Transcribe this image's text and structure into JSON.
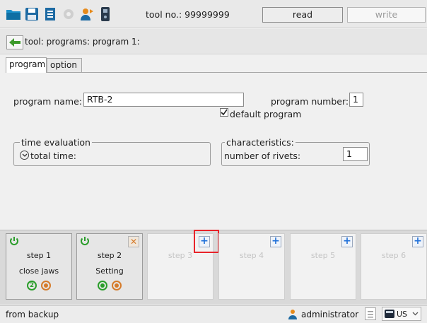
{
  "toolbar": {
    "icons": [
      "folder-icon",
      "save-icon",
      "document-list-icon",
      "settings-gear-icon",
      "user-transfer-icon",
      "device-icon"
    ],
    "tool_no": "tool no.: 99999999",
    "read_label": "read",
    "write_label": "write"
  },
  "breadcrumb": {
    "text": "tool: programs: program 1:"
  },
  "tabs": [
    {
      "label": "program",
      "active": true
    },
    {
      "label": "option",
      "active": false
    }
  ],
  "program": {
    "name_label": "program name:",
    "name_value": "RTB-2",
    "number_label": "program number:",
    "number_value": "1",
    "default_checkbox_label": "default program",
    "default_checked": true
  },
  "time_evaluation": {
    "title": "time evaluation",
    "total_time_label": "total time:"
  },
  "characteristics": {
    "title": "characteristics:",
    "rivets_label": "number of rivets:",
    "rivets_value": "1"
  },
  "steps": [
    {
      "label": "step 1",
      "desc": "close jaws",
      "state": "active",
      "badge": "2"
    },
    {
      "label": "step 2",
      "desc": "Setting",
      "state": "active",
      "badge": ""
    },
    {
      "label": "step 3",
      "desc": "",
      "state": "empty"
    },
    {
      "label": "step 4",
      "desc": "",
      "state": "empty"
    },
    {
      "label": "step 5",
      "desc": "",
      "state": "empty"
    },
    {
      "label": "step 6",
      "desc": "",
      "state": "empty"
    }
  ],
  "status": {
    "left_text": "from backup",
    "user": "administrator",
    "language": "US"
  },
  "colors": {
    "accent_green": "#2a9d2a",
    "accent_orange": "#d57b2a",
    "accent_blue": "#1e6fd9",
    "highlight_red": "#e8232a"
  }
}
